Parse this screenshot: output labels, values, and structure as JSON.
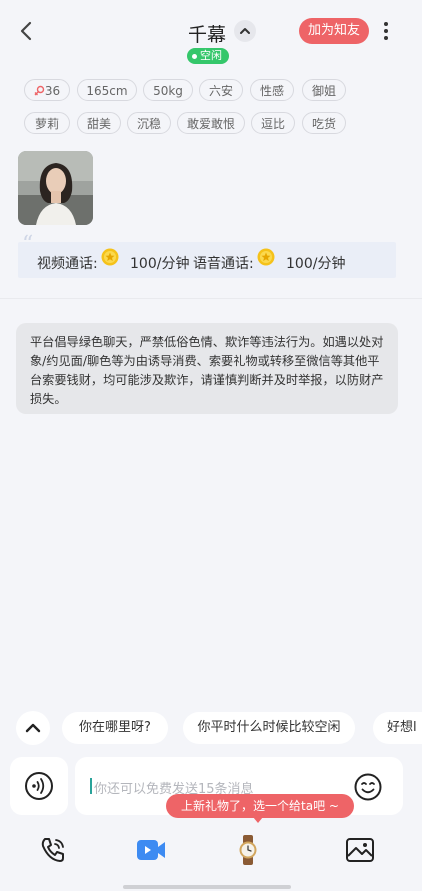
{
  "header": {
    "title": "千幕",
    "status": "空闲",
    "add_friend": "加为知友"
  },
  "tags_row1": [
    "36",
    "165cm",
    "50kg",
    "六安",
    "性感",
    "御姐"
  ],
  "tags_row2": [
    "萝莉",
    "甜美",
    "沉稳",
    "敢爱敢恨",
    "逗比",
    "吃货"
  ],
  "prices": {
    "video_label": "视频通话:",
    "video_price": "100/分钟",
    "voice_label": "语音通话:",
    "voice_price": "100/分钟"
  },
  "notice": "平台倡导绿色聊天，严禁低俗色情、欺诈等违法行为。如遇以处对象/约见面/聊色等为由诱导消费、索要礼物或转移至微信等其他平台索要钱财，均可能涉及欺诈，请谨慎判断并及时举报，以防财产损失。",
  "quick_replies": [
    "你在哪里呀?",
    "你平时什么时候比较空闲",
    "好想l"
  ],
  "input": {
    "placeholder": "你还可以免费发送15条消息"
  },
  "gift_tooltip": "上新礼物了，选一个给ta吧 ~",
  "colors": {
    "accent": "#ee6467",
    "status_green": "#35c76b",
    "background": "#f4f5f9"
  },
  "icons": [
    "back-arrow-icon",
    "chevron-up-icon",
    "more-vertical-icon",
    "female-icon",
    "coin-icon",
    "voice-wave-icon",
    "smile-emoji-icon",
    "phone-call-icon",
    "video-camera-icon",
    "watch-gift-icon",
    "image-gallery-icon"
  ]
}
